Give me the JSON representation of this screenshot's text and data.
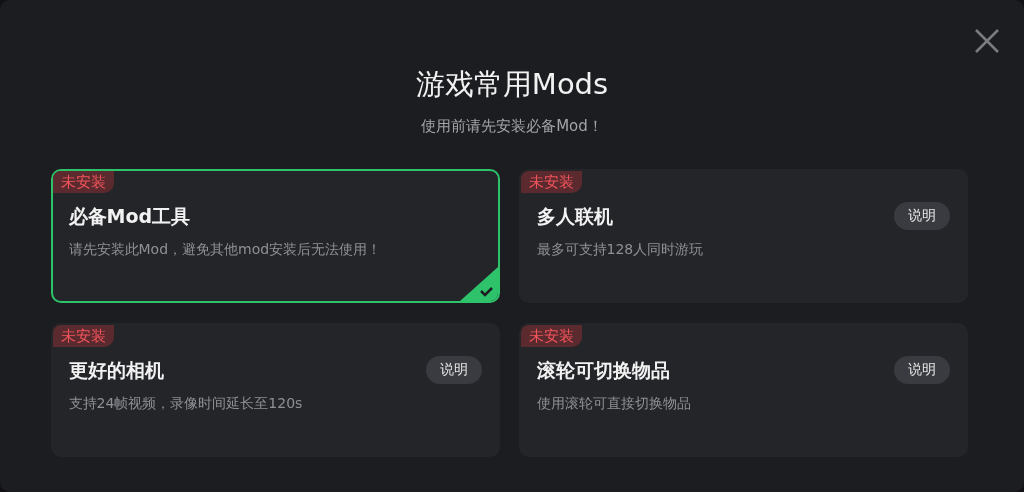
{
  "dialog": {
    "title": "游戏常用Mods",
    "subtitle": "使用前请先安装必备Mod！"
  },
  "mods": [
    {
      "status": "未安装",
      "name": "必备Mod工具",
      "description": "请先安装此Mod，避免其他mod安装后无法使用！",
      "selected": true
    },
    {
      "status": "未安装",
      "name": "多人联机",
      "description": "最多可支持128人同时游玩",
      "selected": false,
      "info_button": "说明"
    },
    {
      "status": "未安装",
      "name": "更好的相机",
      "description": "支持24帧视频，录像时间延长至120s",
      "selected": false,
      "info_button": "说明"
    },
    {
      "status": "未安装",
      "name": "滚轮可切换物品",
      "description": "使用滚轮可直接切换物品",
      "selected": false,
      "info_button": "说明"
    }
  ]
}
